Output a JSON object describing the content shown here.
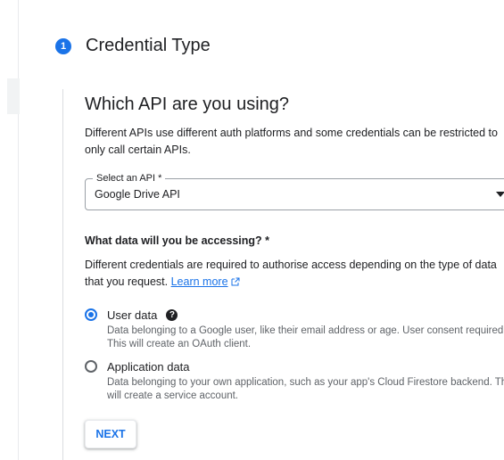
{
  "step": {
    "number": "1",
    "title": "Credential Type"
  },
  "api_section": {
    "title": "Which API are you using?",
    "description": "Different APIs use different auth platforms and some credentials can be restricted to only call certain APIs.",
    "select": {
      "label": "Select an API *",
      "value": "Google Drive API"
    }
  },
  "data_section": {
    "title": "What data will you be accessing? *",
    "description": "Different credentials are required to authorise access depending on the type of data that you request.",
    "learn_more": "Learn more",
    "options": [
      {
        "label": "User data",
        "help": "Data belonging to a Google user, like their email address or age. User consent required. This will create an OAuth client.",
        "checked": true
      },
      {
        "label": "Application data",
        "help": "Data belonging to your own application, such as your app's Cloud Firestore backend. This will create a service account.",
        "checked": false
      }
    ]
  },
  "next_label": "NEXT",
  "colors": {
    "accent": "#1a73e8",
    "text": "#202124",
    "secondary_text": "#5f6368"
  },
  "icons": {
    "help": "help-icon",
    "external_link": "external-link-icon",
    "dropdown": "chevron-down-icon"
  }
}
